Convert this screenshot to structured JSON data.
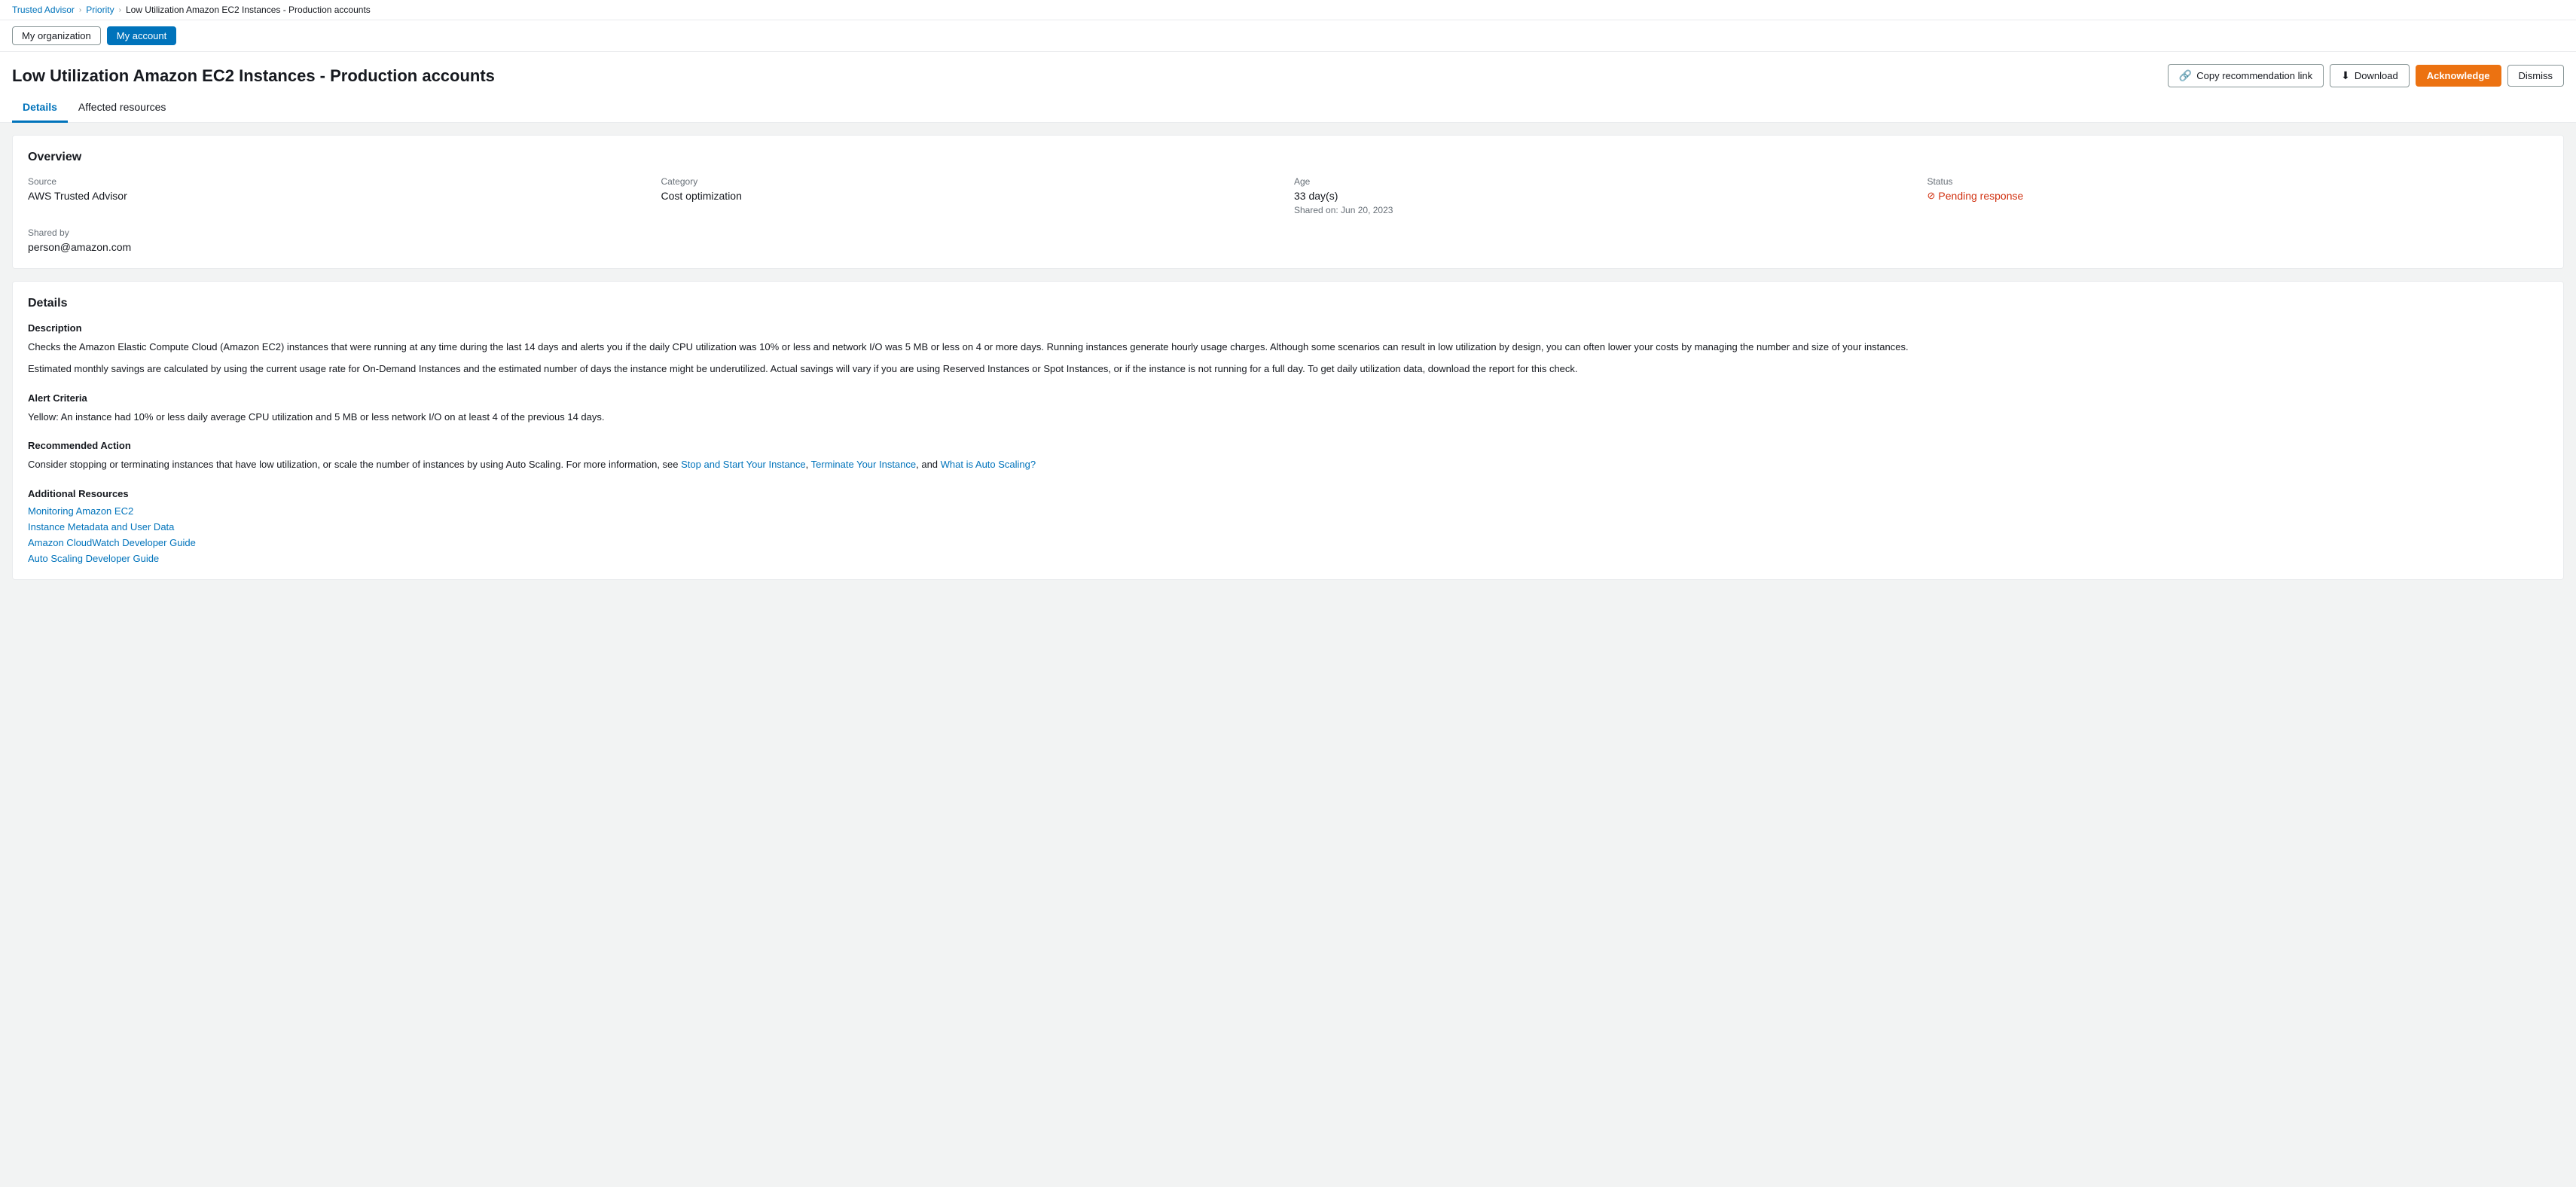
{
  "breadcrumb": {
    "items": [
      {
        "label": "Trusted Advisor",
        "href": "#"
      },
      {
        "label": "Priority",
        "href": "#"
      },
      {
        "label": "Low Utilization Amazon EC2 Instances - Production accounts"
      }
    ]
  },
  "scope_tabs": {
    "items": [
      {
        "label": "My organization",
        "active": false
      },
      {
        "label": "My account",
        "active": true
      }
    ]
  },
  "page": {
    "title": "Low Utilization Amazon EC2 Instances - Production accounts"
  },
  "header_actions": {
    "copy_label": "Copy recommendation link",
    "download_label": "Download",
    "acknowledge_label": "Acknowledge",
    "dismiss_label": "Dismiss"
  },
  "tabs": {
    "items": [
      {
        "label": "Details",
        "active": true
      },
      {
        "label": "Affected resources",
        "active": false
      }
    ]
  },
  "overview": {
    "title": "Overview",
    "source_label": "Source",
    "source_value": "AWS Trusted Advisor",
    "category_label": "Category",
    "category_value": "Cost optimization",
    "age_label": "Age",
    "age_value": "33 day(s)",
    "age_shared": "Shared on: Jun 20, 2023",
    "status_label": "Status",
    "status_value": "Pending response",
    "shared_by_label": "Shared by",
    "shared_by_value": "person@amazon.com"
  },
  "details": {
    "title": "Details",
    "description_label": "Description",
    "description_text1": "Checks the Amazon Elastic Compute Cloud (Amazon EC2) instances that were running at any time during the last 14 days and alerts you if the daily CPU utilization was 10% or less and network I/O was 5 MB or less on 4 or more days. Running instances generate hourly usage charges. Although some scenarios can result in low utilization by design, you can often lower your costs by managing the number and size of your instances.",
    "description_text2": "Estimated monthly savings are calculated by using the current usage rate for On-Demand Instances and the estimated number of days the instance might be underutilized. Actual savings will vary if you are using Reserved Instances or Spot Instances, or if the instance is not running for a full day. To get daily utilization data, download the report for this check.",
    "alert_label": "Alert Criteria",
    "alert_text": "Yellow: An instance had 10% or less daily average CPU utilization and 5 MB or less network I/O on at least 4 of the previous 14 days.",
    "recommended_label": "Recommended Action",
    "recommended_text_prefix": "Consider stopping or terminating instances that have low utilization, or scale the number of instances by using Auto Scaling. For more information, see ",
    "recommended_link1_label": "Stop and Start Your Instance",
    "recommended_link1_href": "#",
    "recommended_link2_label": "Terminate Your Instance",
    "recommended_link2_href": "#",
    "recommended_link3_label": "What is Auto Scaling?",
    "recommended_link3_href": "#",
    "additional_label": "Additional Resources",
    "additional_links": [
      {
        "label": "Monitoring Amazon EC2",
        "href": "#"
      },
      {
        "label": "Instance Metadata and User Data",
        "href": "#"
      },
      {
        "label": "Amazon CloudWatch Developer Guide",
        "href": "#"
      },
      {
        "label": "Auto Scaling Developer Guide",
        "href": "#"
      }
    ]
  }
}
